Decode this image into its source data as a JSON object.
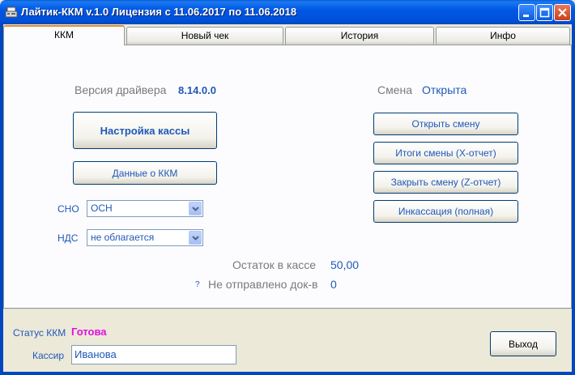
{
  "window": {
    "title": "Лайтик-ККМ v.1.0  Лицензия с 11.06.2017 по 11.06.2018"
  },
  "tabs": [
    {
      "label": "ККМ",
      "active": true
    },
    {
      "label": "Новый чек",
      "active": false
    },
    {
      "label": "История",
      "active": false
    },
    {
      "label": "Инфо",
      "active": false
    }
  ],
  "driver": {
    "label": "Версия драйвера",
    "value": "8.14.0.0"
  },
  "shift": {
    "label": "Смена",
    "value": "Открыта"
  },
  "buttons": {
    "setup_kassa": "Настройка кассы",
    "kkm_data": "Данные о ККМ",
    "open_shift": "Открыть смену",
    "x_report": "Итоги смены (X-отчет)",
    "z_report": "Закрыть смену (Z-отчет)",
    "encashment": "Инкассация (полная)",
    "exit": "Выход"
  },
  "sno": {
    "label": "СНО",
    "value": "ОСН"
  },
  "nds": {
    "label": "НДС",
    "value": "не облагается"
  },
  "cash_balance": {
    "label": "Остаток в кассе",
    "value": "50,00"
  },
  "unsent_docs": {
    "marker": "?",
    "label": "Не отправлено док-в",
    "value": "0"
  },
  "status": {
    "label": "Статус ККМ",
    "value": "Готова"
  },
  "cashier": {
    "label": "Кассир",
    "value": "Иванова"
  },
  "colors": {
    "accent_blue": "#2058b8",
    "status_ready": "#e010e0",
    "titlebar": "#0058e6"
  }
}
